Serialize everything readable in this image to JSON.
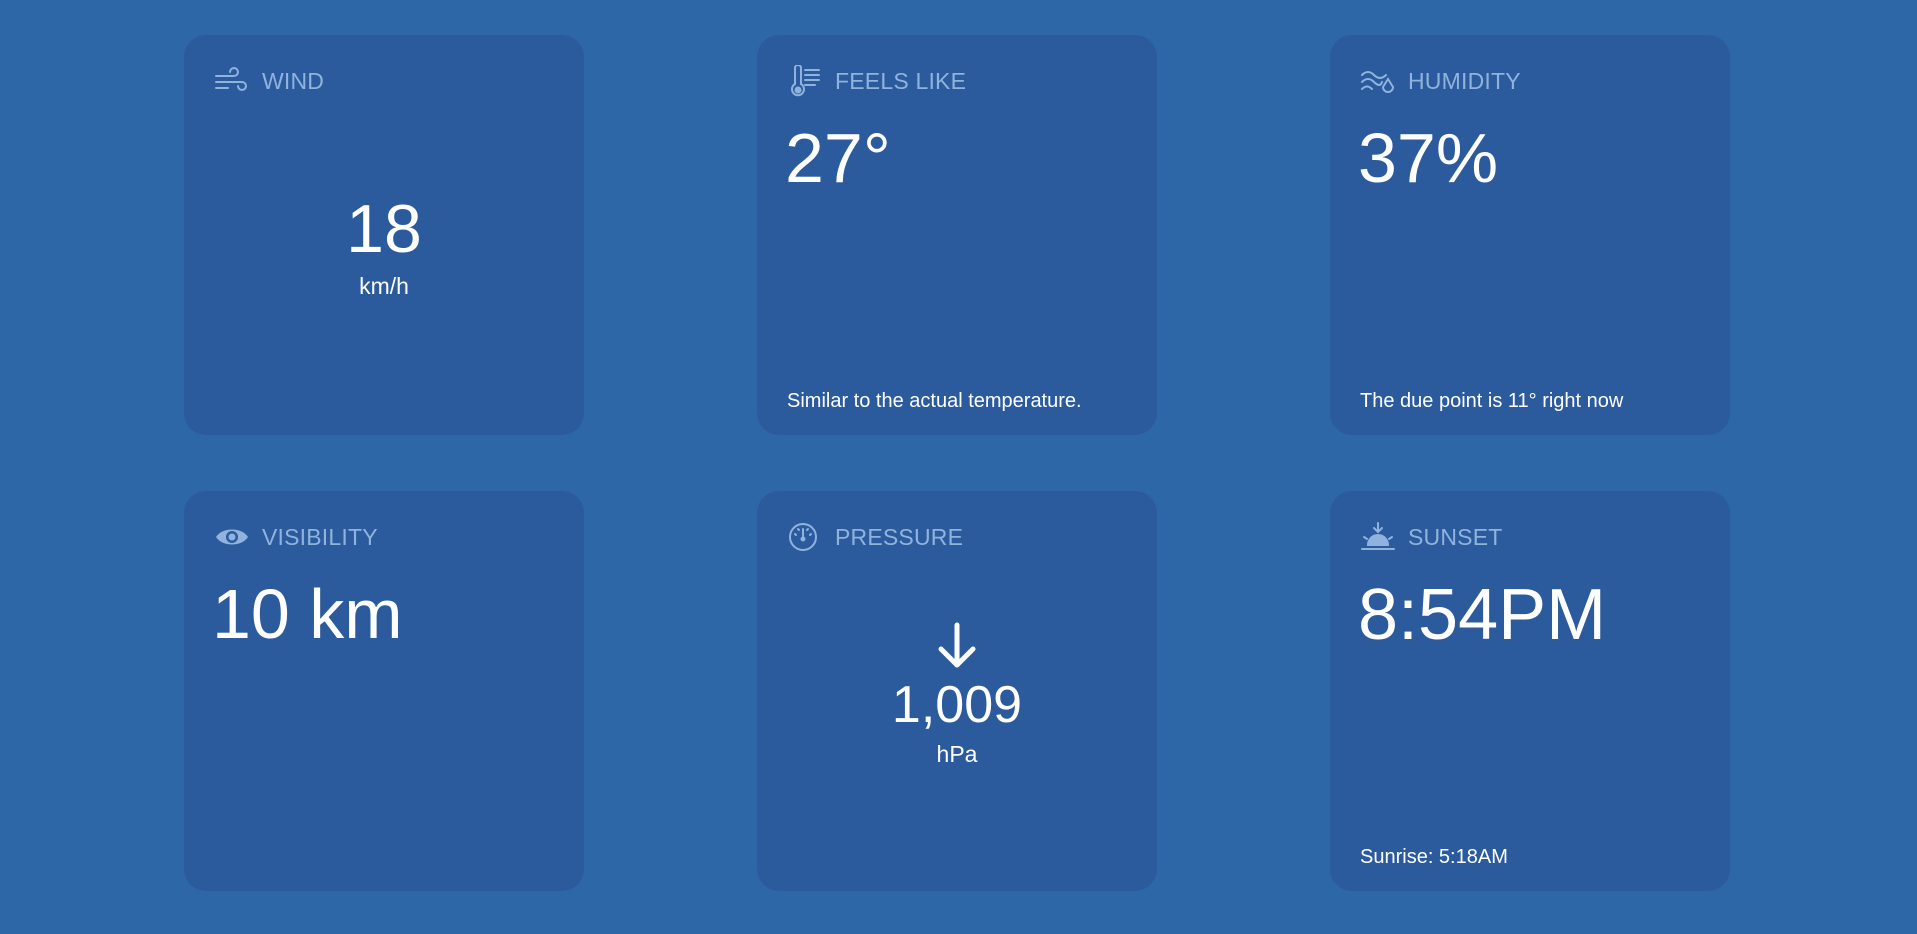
{
  "cards": {
    "wind": {
      "title": "WIND",
      "icon": "wind-icon",
      "value": "18",
      "unit": "km/h"
    },
    "feels_like": {
      "title": "FEELS LIKE",
      "icon": "thermometer-icon",
      "value": "27°",
      "description": "Similar to the actual temperature."
    },
    "humidity": {
      "title": "HUMIDITY",
      "icon": "humidity-icon",
      "value": "37%",
      "description": "The due point is 11° right now"
    },
    "visibility": {
      "title": "VISIBILITY",
      "icon": "eye-icon",
      "value": "10 km"
    },
    "pressure": {
      "title": "PRESSURE",
      "icon": "gauge-icon",
      "trend_icon": "arrow-down-icon",
      "value": "1,009",
      "unit": "hPa"
    },
    "sunset": {
      "title": "SUNSET",
      "icon": "sunset-icon",
      "value": "8:54PM",
      "description": "Sunrise: 5:18AM"
    }
  },
  "colors": {
    "page_background": "#2e67a8",
    "card_background": "#2b5b9d",
    "label_color": "#8fb3dc",
    "text_color": "#ffffff"
  }
}
